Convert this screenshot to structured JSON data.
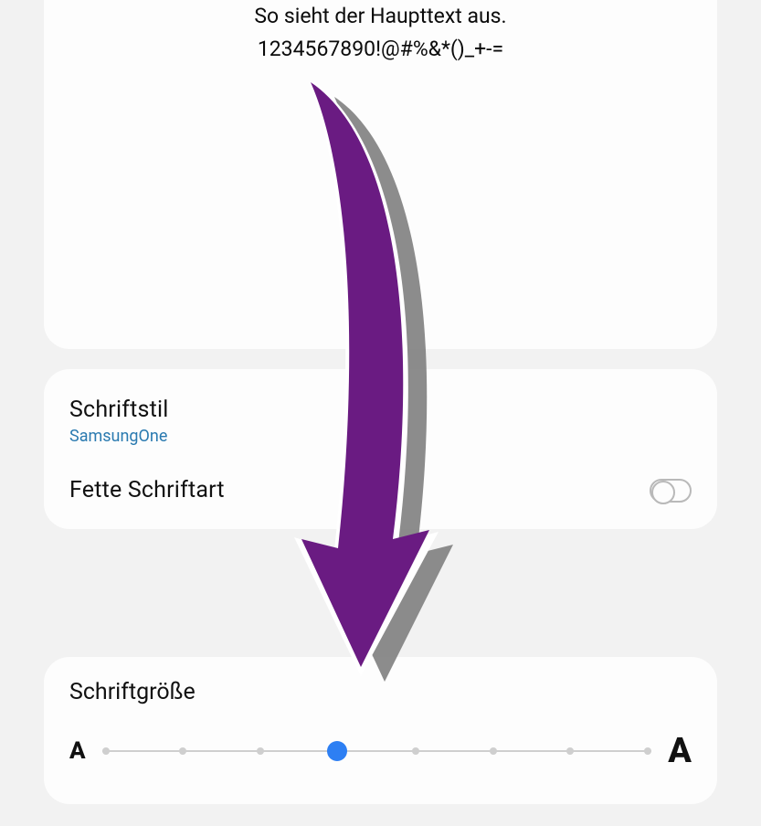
{
  "preview": {
    "line1": "So sieht der Haupttext aus.",
    "line2": "1234567890!@#%&*()_+-="
  },
  "fontStyle": {
    "title": "Schriftstil",
    "value": "SamsungOne"
  },
  "boldFont": {
    "title": "Fette Schriftart",
    "enabled": false
  },
  "fontSize": {
    "title": "Schriftgröße",
    "steps": 8,
    "currentIndex": 3,
    "smallGlyph": "A",
    "largeGlyph": "A"
  },
  "colors": {
    "accent": "#2d7ff3",
    "link": "#2a7ab0",
    "arrow": "#6a1b82"
  }
}
